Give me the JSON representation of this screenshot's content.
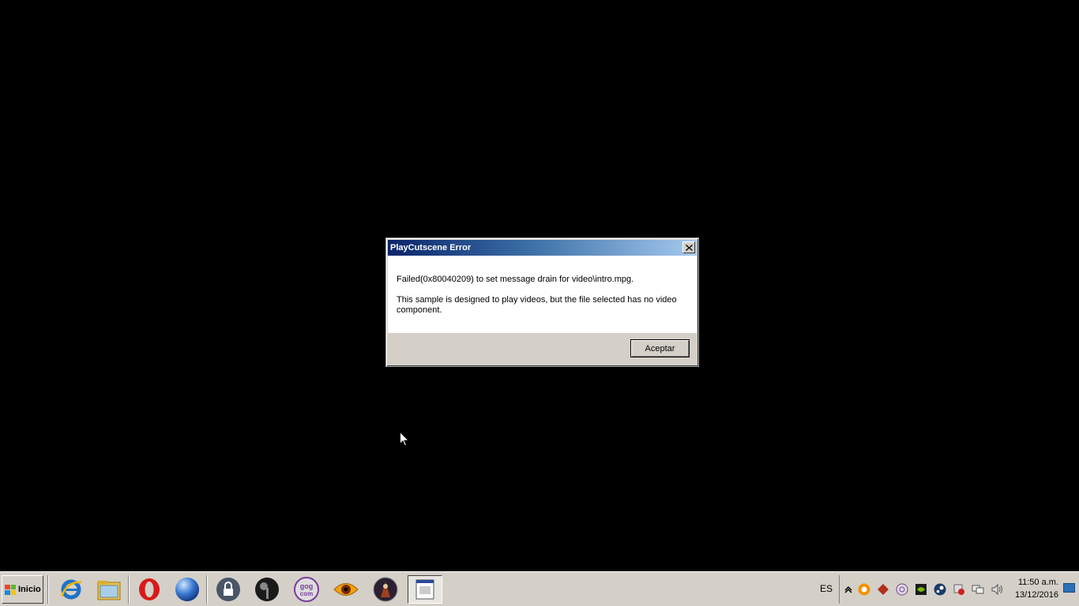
{
  "dialog": {
    "title": "PlayCutscene Error",
    "message_line1": "Failed(0x80040209) to set message drain for video\\intro.mpg.",
    "message_line2": "This sample is designed to play videos, but the file selected has no video component.",
    "ok_label": "Aceptar",
    "close_icon": "close-icon"
  },
  "taskbar": {
    "start_label": "Inicio",
    "pinned": [
      {
        "name": "internet-explorer-icon"
      },
      {
        "name": "file-explorer-icon"
      },
      {
        "name": "opera-icon"
      },
      {
        "name": "globe-browser-icon"
      },
      {
        "name": "lock-app-icon"
      },
      {
        "name": "steam-like-dark-icon"
      },
      {
        "name": "gog-icon",
        "label": "gog com"
      },
      {
        "name": "xnview-eye-icon"
      },
      {
        "name": "game-character-icon"
      },
      {
        "name": "playcutscene-window-icon",
        "active": true
      }
    ],
    "language": "ES",
    "tray_icons": [
      "show-hidden-icons-arrow",
      "avast-icon",
      "game-tray-icon",
      "origin-icon",
      "nvidia-icon",
      "steam-icon",
      "security-flag-icon",
      "network-icon",
      "volume-icon"
    ],
    "clock": {
      "time": "11:50 a.m.",
      "date": "13/12/2016"
    }
  },
  "colors": {
    "desktop": "#000000",
    "title_gradient_start": "#0a246a",
    "title_gradient_end": "#a6caf0",
    "chrome": "#d4d0c8"
  }
}
